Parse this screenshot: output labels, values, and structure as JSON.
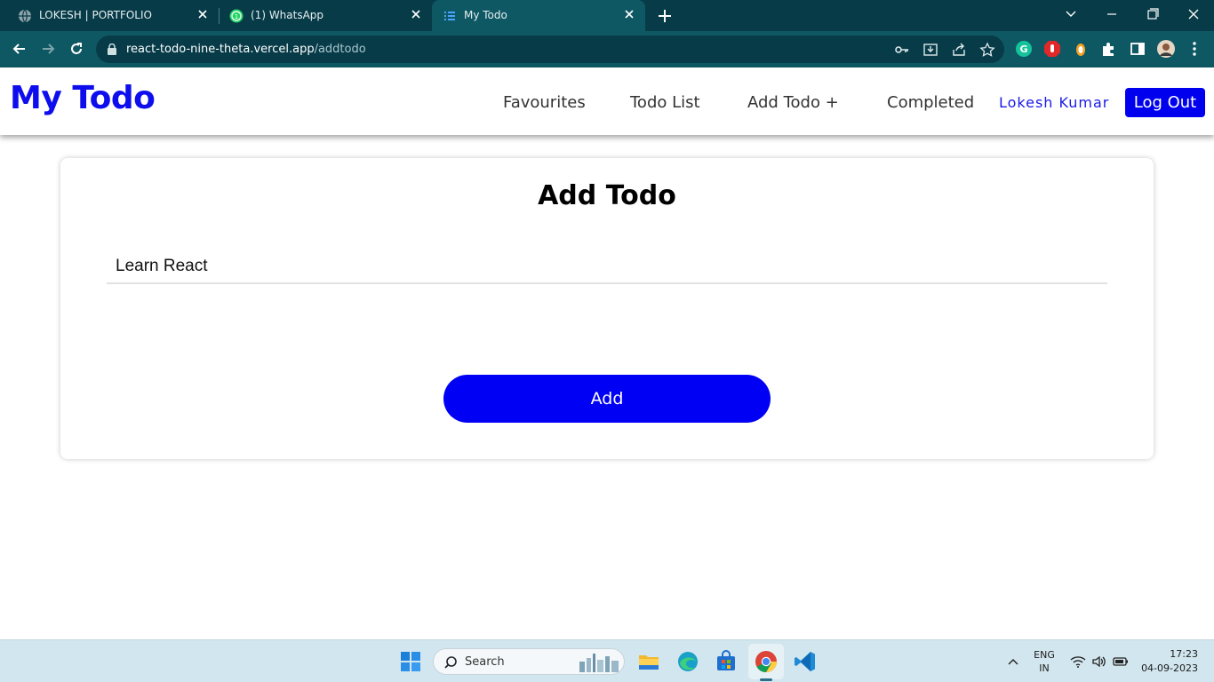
{
  "browser": {
    "tabs": [
      {
        "title": "LOKESH | PORTFOLIO",
        "icon": "globe-icon",
        "active": false
      },
      {
        "title": "(1) WhatsApp",
        "icon": "whatsapp-icon",
        "active": false
      },
      {
        "title": "My Todo",
        "icon": "list-icon",
        "active": true
      }
    ],
    "url_host": "react-todo-nine-theta.vercel.app",
    "url_path": "/addtodo",
    "colors": {
      "tabstrip": "#073b48",
      "toolbar": "#0e5864"
    }
  },
  "app": {
    "brand": "My Todo",
    "nav": {
      "favourites": "Favourites",
      "todo_list": "Todo List",
      "add_todo": "Add Todo +",
      "completed": "Completed"
    },
    "user_name": "Lokesh Kumar",
    "logout_label": "Log Out",
    "colors": {
      "brand": "#0d0ded",
      "primary_button": "#0000f5"
    }
  },
  "form": {
    "title": "Add Todo",
    "todo_value": "Learn React",
    "add_label": "Add"
  },
  "taskbar": {
    "search_label": "Search",
    "lang_line1": "ENG",
    "lang_line2": "IN",
    "time": "17:23",
    "date": "04-09-2023",
    "pinned": [
      "windows-start-icon",
      "file-explorer-icon",
      "edge-icon",
      "microsoft-store-icon",
      "chrome-icon",
      "vscode-icon"
    ]
  }
}
